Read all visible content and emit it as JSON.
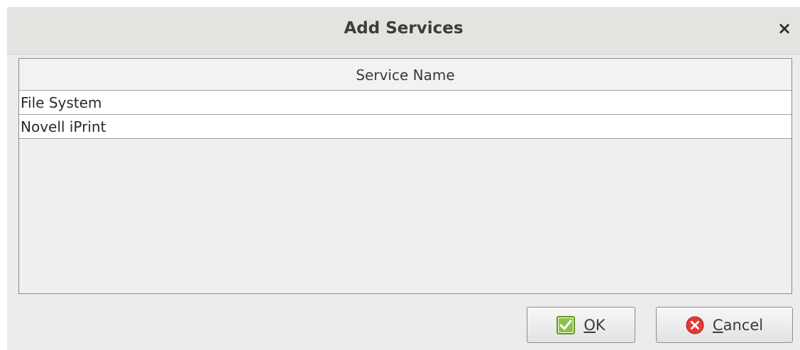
{
  "dialog": {
    "title": "Add Services",
    "close_icon": "close-icon"
  },
  "table": {
    "columns": [
      "Service Name"
    ],
    "rows": [
      {
        "name": "File System"
      },
      {
        "name": "Novell iPrint"
      }
    ]
  },
  "buttons": {
    "ok": {
      "mnemonic": "O",
      "rest": "K",
      "icon": "check-icon",
      "icon_color": "#4caf50"
    },
    "cancel": {
      "mnemonic": "C",
      "rest": "ancel",
      "icon": "cancel-icon",
      "icon_color": "#e53935"
    }
  }
}
